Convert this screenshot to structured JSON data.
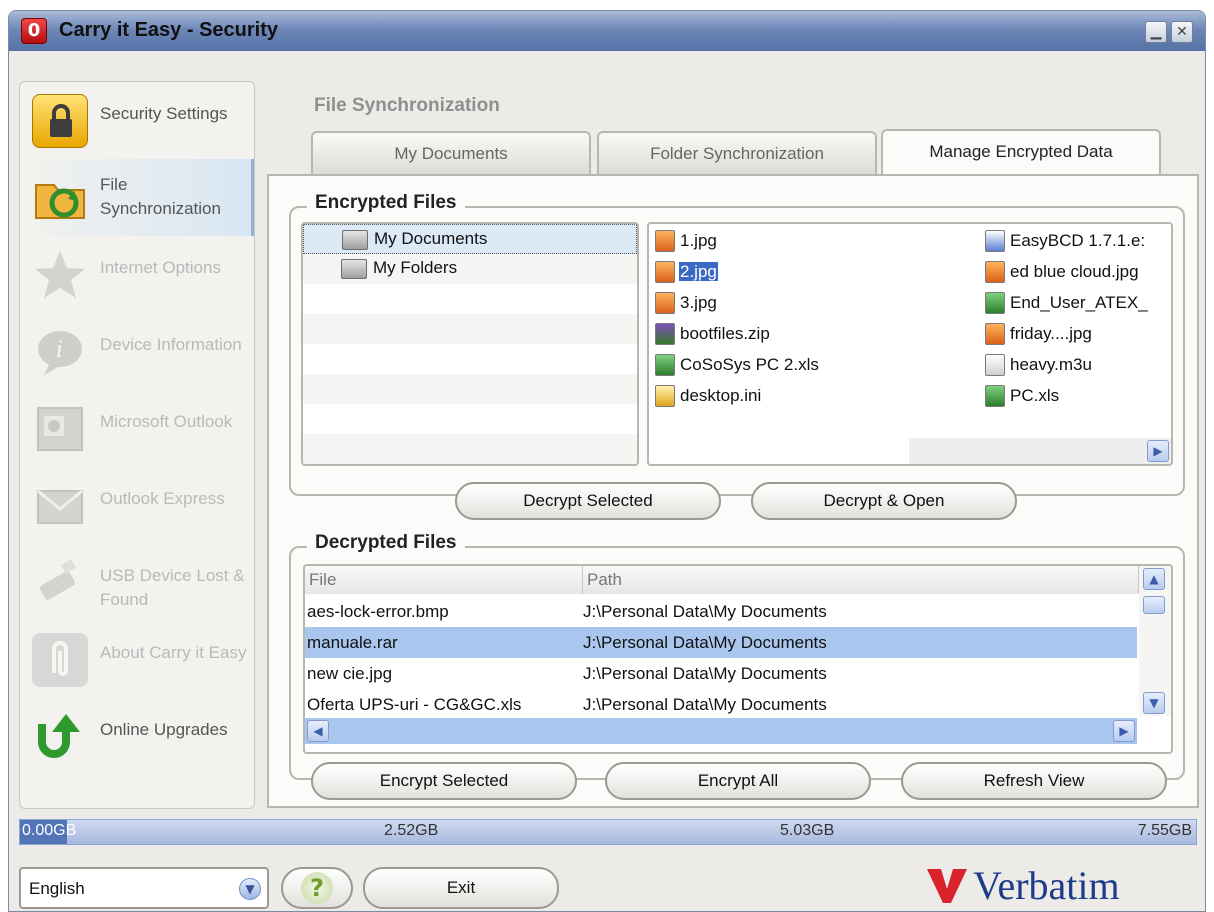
{
  "window": {
    "title": "Carry it Easy - Security"
  },
  "sidebar": {
    "items": [
      {
        "label": "Security Settings",
        "icon": "lock-icon",
        "state": "enabled"
      },
      {
        "label": "File Synchronization",
        "icon": "sync-folder-icon",
        "state": "active"
      },
      {
        "label": "Internet Options",
        "icon": "star-icon",
        "state": "disabled"
      },
      {
        "label": "Device Information",
        "icon": "info-bubble-icon",
        "state": "disabled"
      },
      {
        "label": "Microsoft Outlook",
        "icon": "outlook-icon",
        "state": "disabled"
      },
      {
        "label": "Outlook Express",
        "icon": "outlook-express-icon",
        "state": "disabled"
      },
      {
        "label": "USB Device Lost & Found",
        "icon": "usb-drive-icon",
        "state": "disabled"
      },
      {
        "label": "About Carry it Easy",
        "icon": "paperclip-icon",
        "state": "disabled"
      },
      {
        "label": "Online Upgrades",
        "icon": "upgrade-arrow-icon",
        "state": "enabled"
      }
    ]
  },
  "main": {
    "section_title": "File Synchronization",
    "tabs": [
      {
        "label": "My Documents",
        "selected": false
      },
      {
        "label": "Folder Synchronization",
        "selected": false
      },
      {
        "label": "Manage Encrypted Data",
        "selected": true
      }
    ],
    "encrypted": {
      "title": "Encrypted Files",
      "tree": [
        {
          "label": "My Documents",
          "selected": true
        },
        {
          "label": "My Folders",
          "selected": false
        }
      ],
      "files_col1": [
        {
          "name": "1.jpg",
          "icon": "jpg-file-icon",
          "selected": false
        },
        {
          "name": "2.jpg",
          "icon": "jpg-file-icon",
          "selected": true
        },
        {
          "name": "3.jpg",
          "icon": "jpg-file-icon",
          "selected": false
        },
        {
          "name": "bootfiles.zip",
          "icon": "zip-file-icon",
          "selected": false
        },
        {
          "name": "CoSoSys PC 2.xls",
          "icon": "excel-file-icon",
          "selected": false
        },
        {
          "name": "desktop.ini",
          "icon": "ini-file-icon",
          "selected": false
        }
      ],
      "files_col2": [
        {
          "name": "EasyBCD 1.7.1.e:",
          "icon": "exe-file-icon",
          "selected": false
        },
        {
          "name": "ed blue cloud.jpg",
          "icon": "jpg-file-icon",
          "selected": false
        },
        {
          "name": "End_User_ATEX_",
          "icon": "excel-file-icon",
          "selected": false
        },
        {
          "name": "friday....jpg",
          "icon": "jpg-file-icon",
          "selected": false
        },
        {
          "name": "heavy.m3u",
          "icon": "m3u-file-icon",
          "selected": false
        },
        {
          "name": "PC.xls",
          "icon": "excel-file-icon",
          "selected": false
        }
      ],
      "decrypt_selected_label": "Decrypt Selected",
      "decrypt_open_label": "Decrypt & Open"
    },
    "decrypted": {
      "title": "Decrypted Files",
      "columns": [
        "File",
        "Path"
      ],
      "rows": [
        {
          "file": "aes-lock-error.bmp",
          "path": "J:\\Personal Data\\My Documents",
          "selected": false
        },
        {
          "file": "manuale.rar",
          "path": "J:\\Personal Data\\My Documents",
          "selected": true
        },
        {
          "file": "new cie.jpg",
          "path": "J:\\Personal Data\\My Documents",
          "selected": false
        },
        {
          "file": "Oferta UPS-uri - CG&GC.xls",
          "path": "J:\\Personal Data\\My Documents",
          "selected": false
        }
      ],
      "encrypt_selected_label": "Encrypt Selected",
      "encrypt_all_label": "Encrypt All",
      "refresh_label": "Refresh View"
    }
  },
  "storage": {
    "labels": [
      "0.00GB",
      "2.52GB",
      "5.03GB",
      "7.55GB"
    ],
    "used_fraction": 0.04
  },
  "footer": {
    "language": "English",
    "help_symbol": "?",
    "exit_label": "Exit",
    "brand": "Verbatim"
  },
  "colors": {
    "title_gradient": "#6f88b8",
    "selection": "#3a6ac6",
    "row_selection": "#a9c7ee",
    "brand_blue": "#1d3c8a",
    "brand_red": "#d9222a"
  }
}
